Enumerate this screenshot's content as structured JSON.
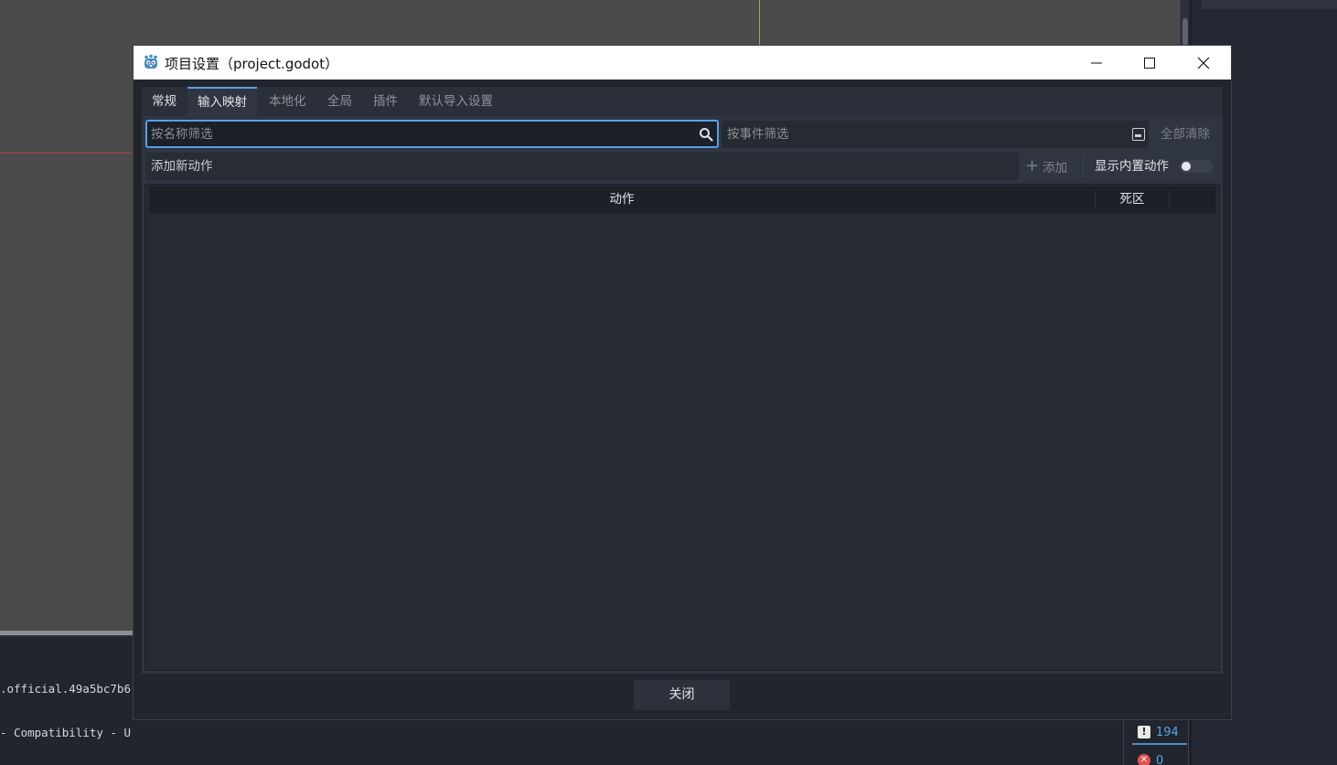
{
  "background": {
    "console_lines": [
      ".official.49a5bc7b6",
      "- Compatibility - U"
    ],
    "warnings_count": "194",
    "errors_count": "0"
  },
  "window": {
    "title": "项目设置（project.godot）",
    "app_icon": "godot-icon",
    "minimize_icon": "minimize-icon",
    "maximize_icon": "maximize-icon",
    "close_icon": "close-icon"
  },
  "tabs": [
    {
      "label": "常规",
      "active": false
    },
    {
      "label": "输入映射",
      "active": true
    },
    {
      "label": "本地化",
      "active": false
    },
    {
      "label": "全局",
      "active": false
    },
    {
      "label": "插件",
      "active": false
    },
    {
      "label": "默认导入设置",
      "active": false
    }
  ],
  "input_map": {
    "filter_name_placeholder": "按名称筛选",
    "filter_name_value": "",
    "filter_event_placeholder": "按事件筛选",
    "filter_event_value": "",
    "clear_all_label": "全部清除",
    "add_action_placeholder": "添加新动作",
    "add_action_value": "",
    "add_button_label": "添加",
    "show_builtin_label": "显示内置动作",
    "show_builtin_enabled": false,
    "columns": [
      "动作",
      "死区"
    ],
    "rows": []
  },
  "footer": {
    "close_label": "关闭"
  },
  "colors": {
    "accent": "#5b9ee8",
    "panel": "#2f3541",
    "dialog_bg": "#21252d"
  }
}
